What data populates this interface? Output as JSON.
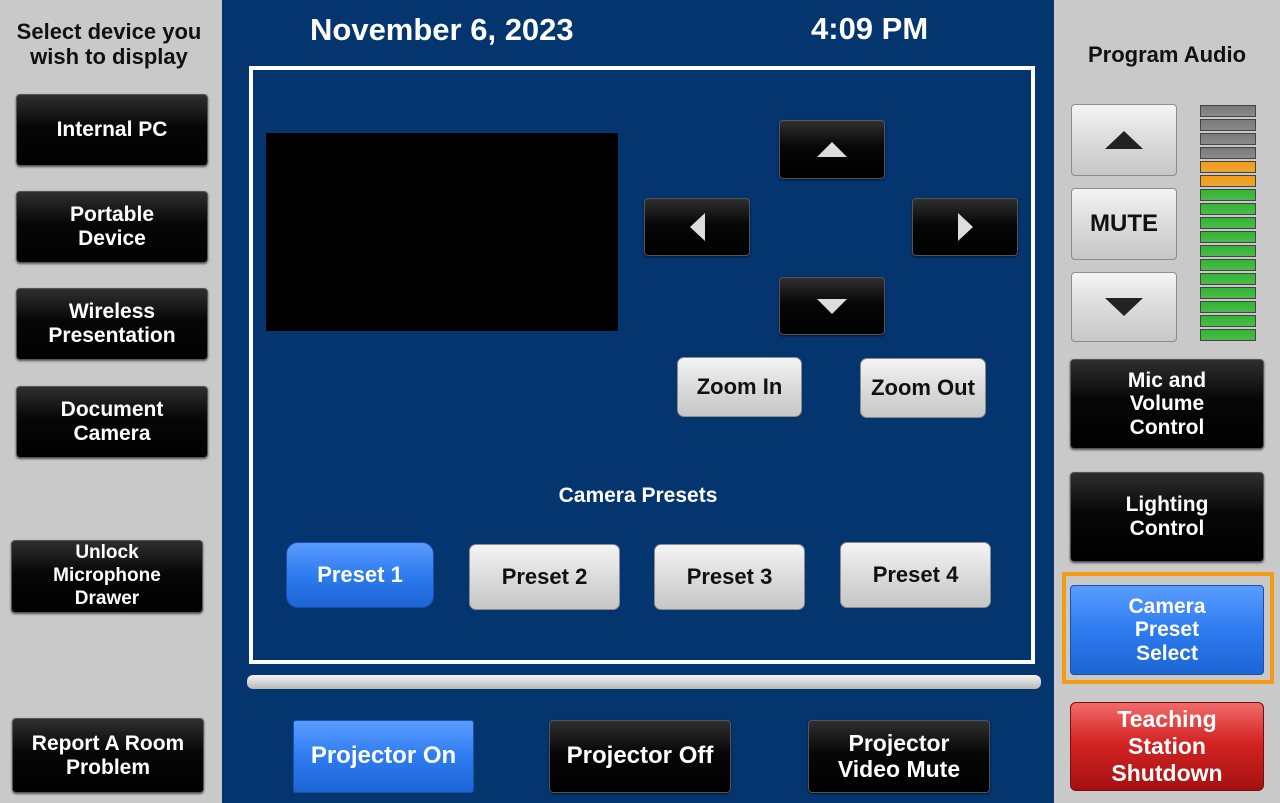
{
  "sidebar": {
    "heading": "Select device you\nwish to display",
    "sources": [
      {
        "label": "Internal PC"
      },
      {
        "label": "Portable\nDevice"
      },
      {
        "label": "Wireless\nPresentation"
      },
      {
        "label": "Document\nCamera"
      }
    ],
    "unlock_label": "Unlock\nMicrophone\nDrawer",
    "report_label": "Report A Room\nProblem"
  },
  "header": {
    "date": "November 6, 2023",
    "time": "4:09 PM"
  },
  "camera": {
    "zoom_in_label": "Zoom In",
    "zoom_out_label": "Zoom Out",
    "presets_heading": "Camera Presets",
    "presets": [
      {
        "label": "Preset 1",
        "active": true
      },
      {
        "label": "Preset 2",
        "active": false
      },
      {
        "label": "Preset 3",
        "active": false
      },
      {
        "label": "Preset 4",
        "active": false
      }
    ],
    "pan_icons": [
      "chevron-up-icon",
      "chevron-left-icon",
      "chevron-right-icon",
      "chevron-down-icon"
    ]
  },
  "projector": {
    "on_label": "Projector On",
    "off_label": "Projector Off",
    "mute_label": "Projector\nVideo Mute"
  },
  "audio": {
    "heading": "Program Audio",
    "mute_label": "MUTE",
    "meter_level_segments": 13,
    "meter_total_segments": 17
  },
  "controls": {
    "mic_volume_label": "Mic and\nVolume\nControl",
    "lighting_label": "Lighting\nControl",
    "camera_preset_label": "Camera\nPreset\nSelect",
    "shutdown_label": "Teaching\nStation\nShutdown"
  },
  "colors": {
    "panel_blue": "#04356f",
    "active_blue": "#2d7cf0",
    "highlight_orange": "#f39c12",
    "shutdown_red": "#d42424",
    "meter_green": "#2fb52f",
    "meter_orange": "#f39c12",
    "meter_grey": "#7a7a7a"
  }
}
